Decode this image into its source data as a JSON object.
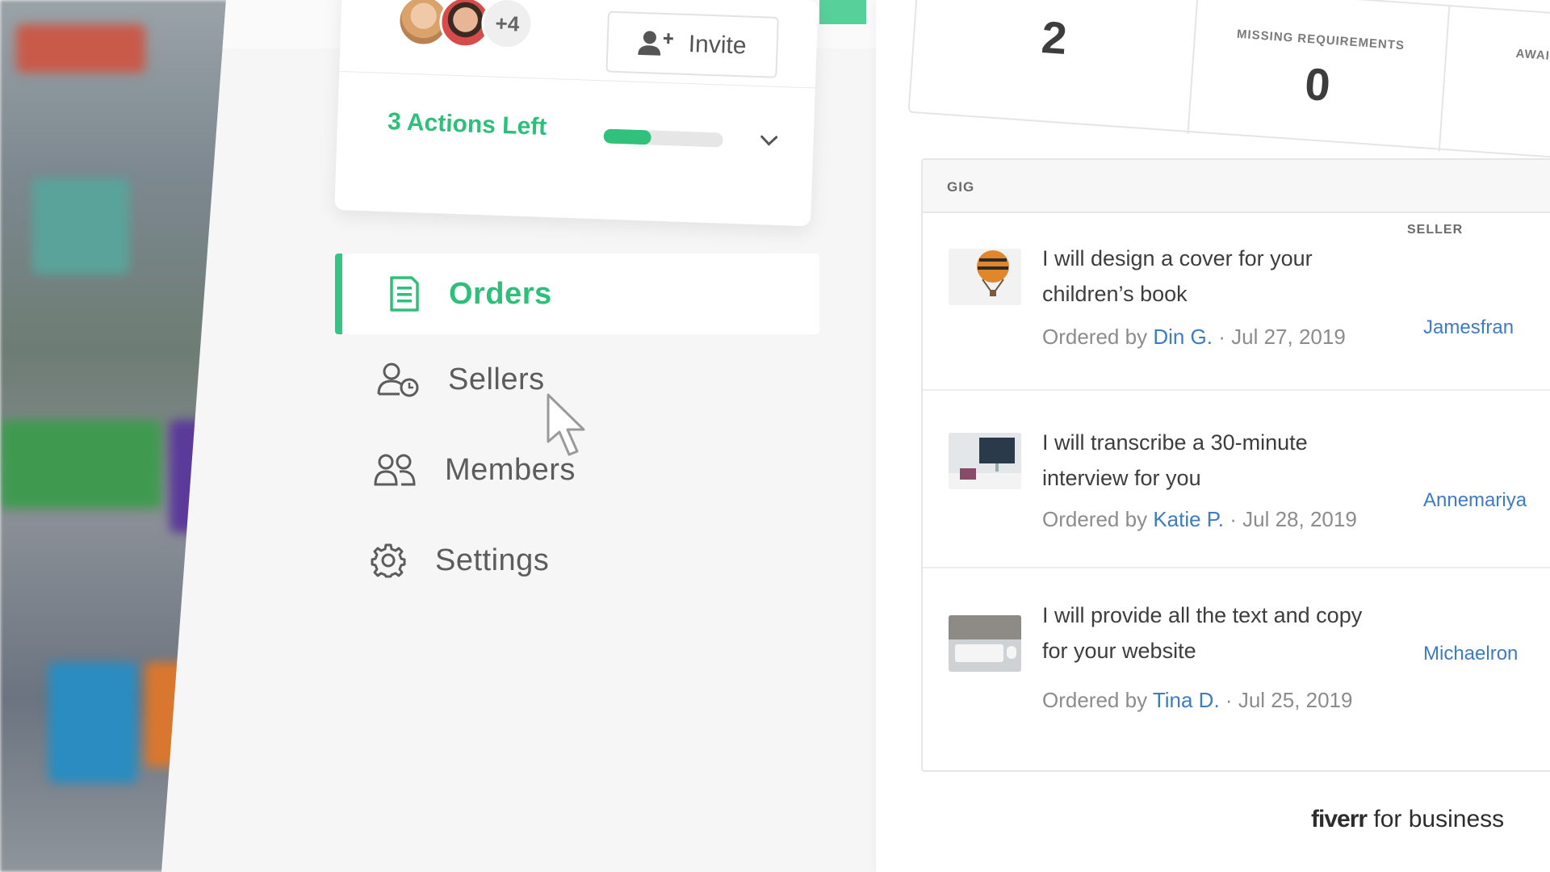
{
  "team": {
    "extra_members": "+4",
    "invite_label": "Invite",
    "actions_left": "3 Actions Left",
    "actions_progress": 0.4
  },
  "nav": {
    "items": [
      {
        "label": "Orders",
        "icon": "document-icon",
        "active": true
      },
      {
        "label": "Sellers",
        "icon": "seller-clock-icon",
        "active": false
      },
      {
        "label": "Members",
        "icon": "members-icon",
        "active": false
      },
      {
        "label": "Settings",
        "icon": "gear-icon",
        "active": false
      }
    ]
  },
  "stats": [
    {
      "label": "",
      "value": "2"
    },
    {
      "label": "Missing Requirements",
      "value": "0"
    },
    {
      "label": "Awaitin",
      "value": ""
    }
  ],
  "table": {
    "headers": {
      "gig": "GIG",
      "seller": "SELLER"
    },
    "rows": [
      {
        "title": "I will design a cover for your children’s book",
        "ordered_by_label": "Ordered by",
        "buyer": "Din G.",
        "date": "Jul 27, 2019",
        "seller": "Jamesfran",
        "thumb": "hot-air-balloon-image"
      },
      {
        "title": "I will transcribe a 30-minute interview for you",
        "ordered_by_label": "Ordered by",
        "buyer": "Katie P.",
        "date": "Jul 28, 2019",
        "seller": "Annemariya",
        "thumb": "desk-monitor-image"
      },
      {
        "title": "I will provide all the text and copy for your website",
        "ordered_by_label": "Ordered by",
        "buyer": "Tina D.",
        "date": "Jul 25, 2019",
        "seller": "Michaelron",
        "thumb": "keyboard-image"
      }
    ]
  },
  "brand": {
    "logo": "fiverr",
    "suffix": "for business"
  },
  "colors": {
    "accent_green": "#2ebf7b",
    "link_blue": "#3d7bc4"
  }
}
